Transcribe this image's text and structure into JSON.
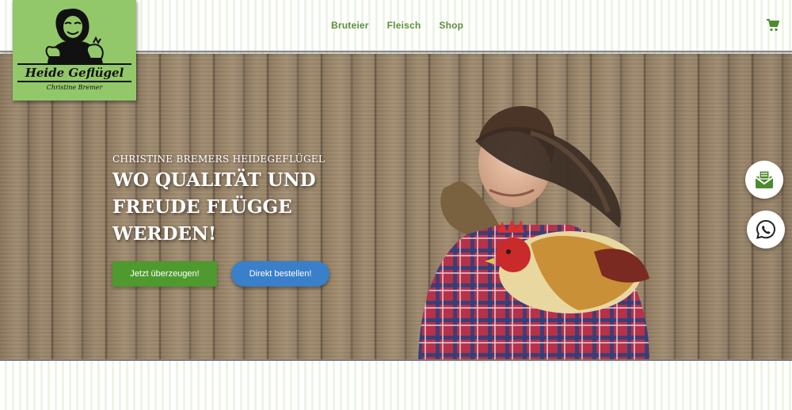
{
  "logo": {
    "title": "Heide Geflügel",
    "subtitle": "Christine Bremer"
  },
  "nav": {
    "items": [
      {
        "label": "Bruteier"
      },
      {
        "label": "Fleisch"
      },
      {
        "label": "Shop"
      }
    ],
    "cart_icon": "cart-icon"
  },
  "hero": {
    "kicker": "CHRISTINE BREMERS HEIDEGEFLÜGEL",
    "headline": "WO QUALITÄT UND FREUDE FLÜGGE WERDEN!",
    "primary_button": "Jetzt überzeugen!",
    "secondary_button": "Direkt bestellen!"
  },
  "floating": {
    "mail_icon": "mail-icon",
    "whatsapp_icon": "whatsapp-icon"
  },
  "colors": {
    "brand_green": "#5d8f3a",
    "logo_bg": "#93c86a",
    "button_green": "#4f9a2e",
    "button_blue": "#3a7fc9"
  }
}
